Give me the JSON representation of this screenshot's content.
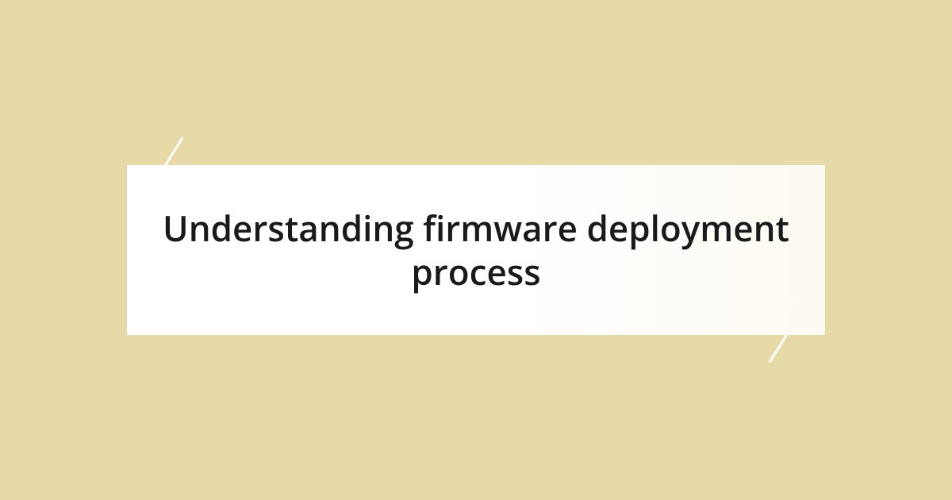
{
  "card": {
    "title": "Understanding firmware deployment process"
  },
  "colors": {
    "background": "#e8d9a9",
    "card_background": "#ffffff",
    "text": "#1a1a1a",
    "accent": "#ffffff"
  }
}
